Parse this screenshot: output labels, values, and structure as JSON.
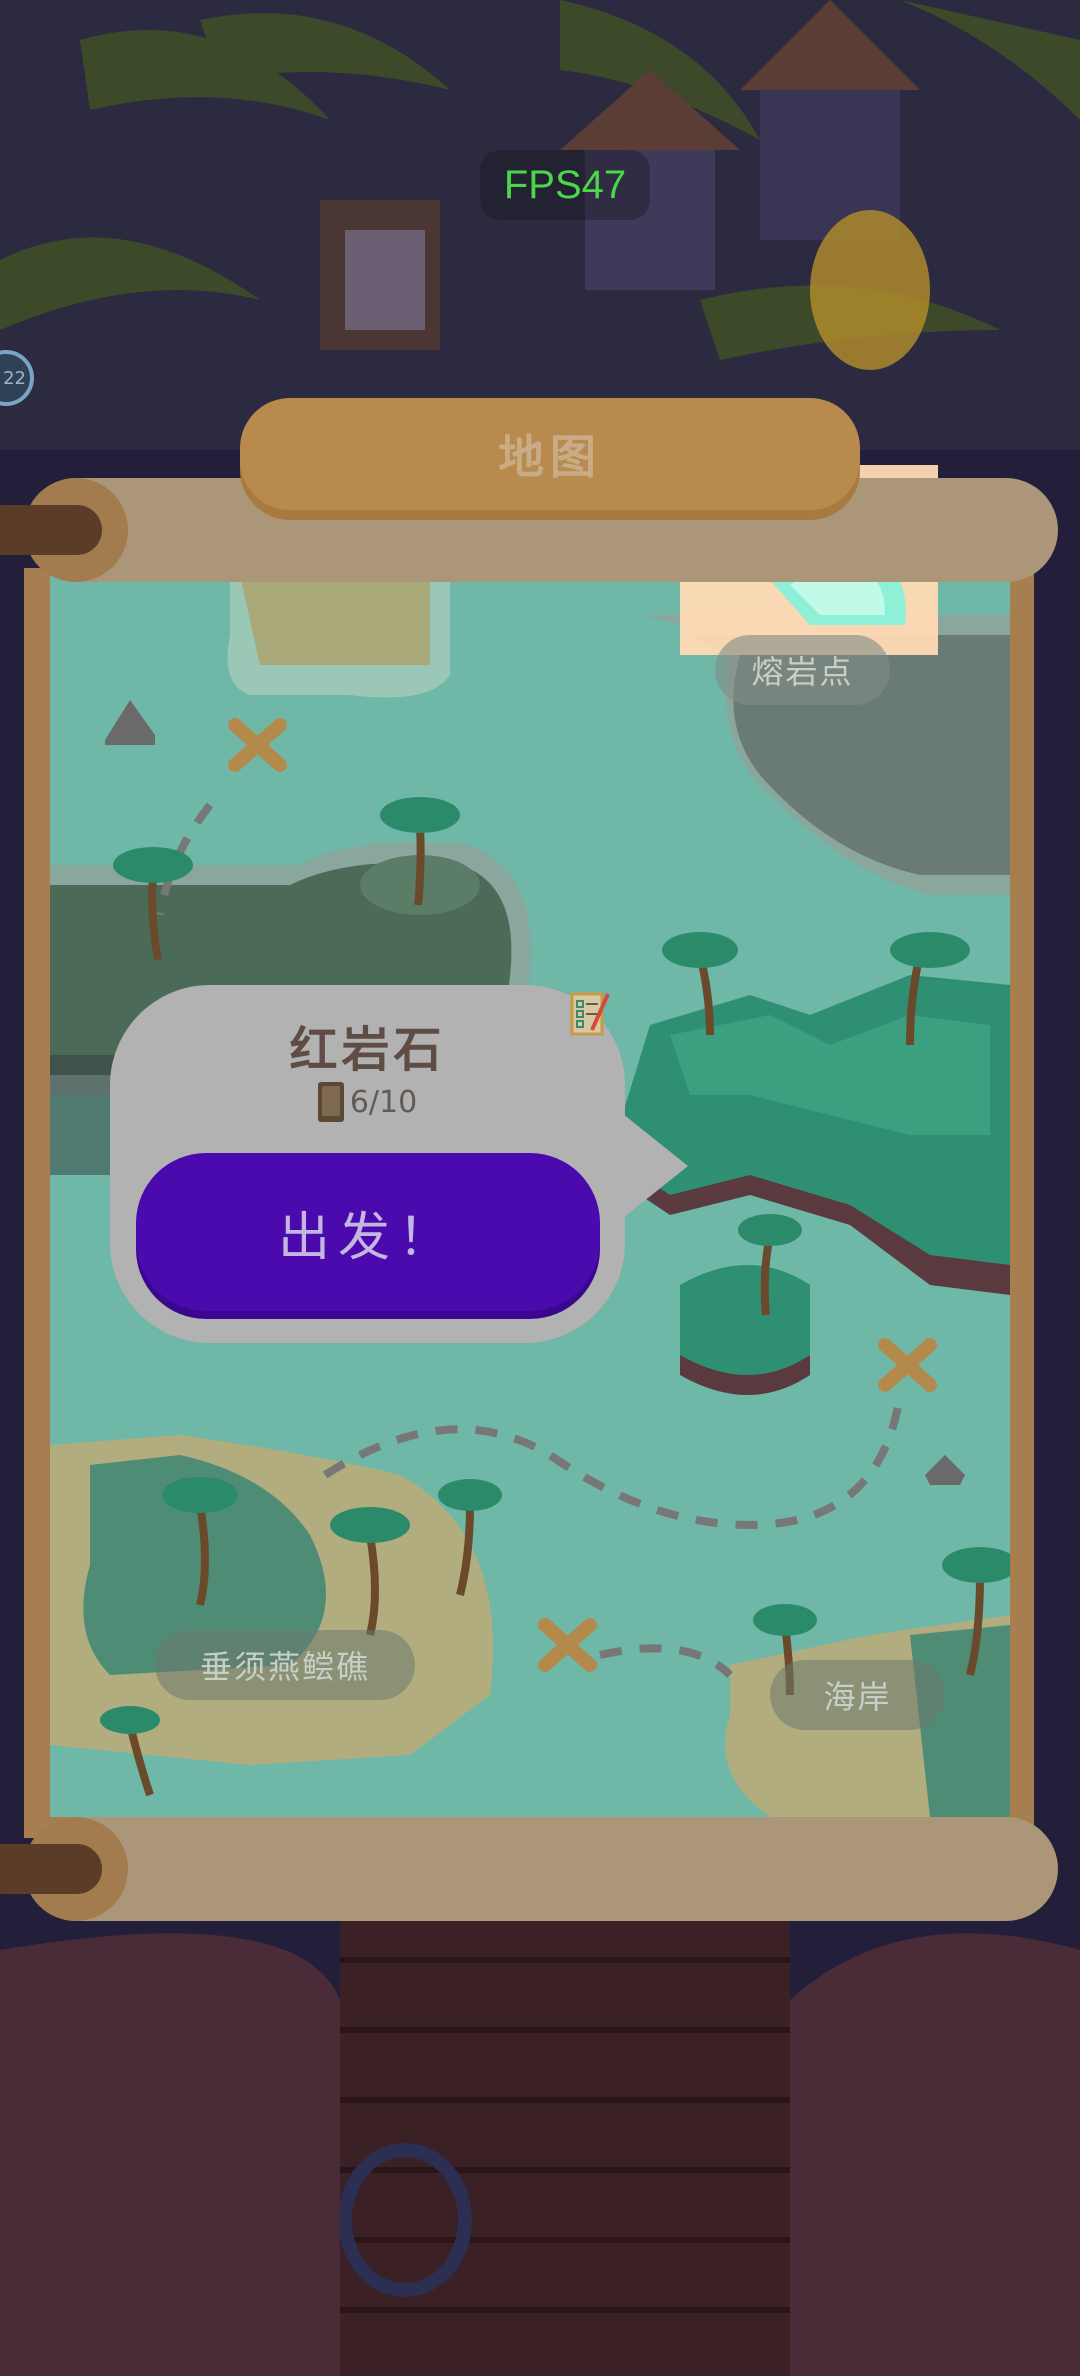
{
  "hud": {
    "fps": "FPS47",
    "side_badge": "22"
  },
  "map": {
    "title": "地图",
    "locations": {
      "lava_point": "熔岩点",
      "beard_rock": "垂须燕鲿礁",
      "coast": "海岸"
    }
  },
  "popup": {
    "location_name": "红岩石",
    "progress": "6/10",
    "go_button": "出发！"
  },
  "colors": {
    "sea": "#6fb7a6",
    "button": "#4a0aad",
    "scroll": "#ac9679",
    "fps": "#4cd64a"
  },
  "icons": [
    "book-icon",
    "checklist-icon"
  ]
}
